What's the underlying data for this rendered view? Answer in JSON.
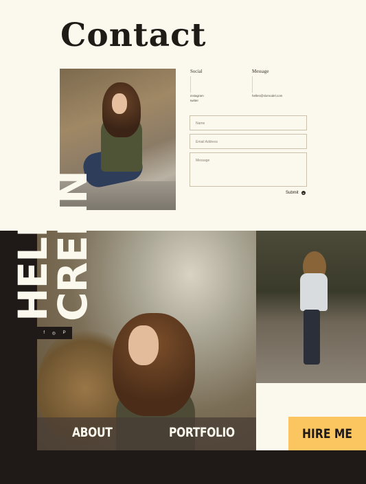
{
  "page": {
    "title": "Contact"
  },
  "social": {
    "label": "Social",
    "links": [
      "instagram",
      "twitter"
    ]
  },
  "message": {
    "label": "Message",
    "email": "hellen@slomodel.com"
  },
  "form": {
    "name_placeholder": "Name",
    "email_placeholder": "Email Address",
    "message_placeholder": "Message",
    "submit_label": "Submit"
  },
  "brand": {
    "first": "HELLEN",
    "last": "CRENN"
  },
  "social_icons": [
    "facebook-icon",
    "instagram-icon",
    "pinterest-icon"
  ],
  "social_glyphs": [
    "f",
    "◎",
    "P"
  ],
  "nav": {
    "about": "ABOUT",
    "portfolio": "PORTFOLIO",
    "hire": "HIRE ME"
  },
  "colors": {
    "accent": "#fbc560",
    "dark": "#1f1a17",
    "cream": "#fbf8ed"
  }
}
